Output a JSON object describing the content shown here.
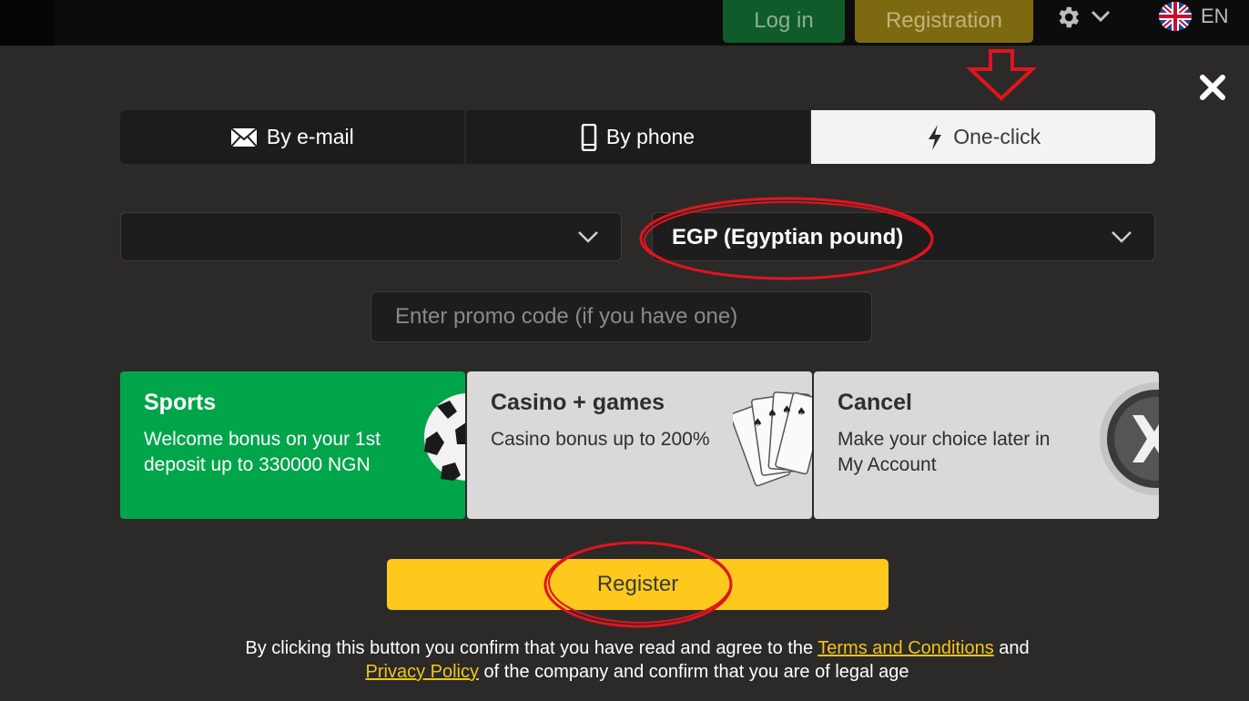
{
  "header": {
    "login_label": "Log in",
    "registration_label": "Registration",
    "language": "EN"
  },
  "tabs": [
    {
      "label": "By e-mail",
      "icon": "envelope-icon",
      "active": false
    },
    {
      "label": "By phone",
      "icon": "phone-icon",
      "active": false
    },
    {
      "label": "One-click",
      "icon": "lightning-icon",
      "active": true
    }
  ],
  "form": {
    "country_value": "",
    "currency_value": "EGP (Egyptian pound)",
    "promo_placeholder": "Enter promo code (if you have one)"
  },
  "bonuses": {
    "sports": {
      "title": "Sports",
      "desc": "Welcome bonus on your 1st deposit up to 330000 NGN"
    },
    "casino": {
      "title": "Casino + games",
      "desc": "Casino bonus up to 200%"
    },
    "cancel": {
      "title": "Cancel",
      "desc": "Make your choice later in My Account"
    }
  },
  "register_label": "Register",
  "terms": {
    "prefix": "By clicking this button you confirm that you have read and agree to the",
    "terms_link": "Terms and Conditions",
    "and": "and",
    "privacy_link": "Privacy Policy",
    "suffix": "of the company and confirm that you are of legal age"
  },
  "colors": {
    "accent_yellow": "#fdc91d",
    "sports_green": "#00a54a",
    "annotation_red": "#e0141e"
  }
}
